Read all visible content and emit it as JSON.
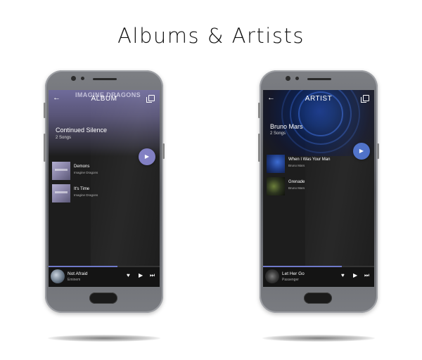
{
  "headline": "Albums & Artists",
  "left_phone": {
    "hero_title": "ALBUM",
    "hero_band_text": "IMAGINE DRAGONS",
    "item_name": "Continued Silence",
    "item_count": "2 Songs",
    "songs": [
      {
        "name": "Demons",
        "artist": "Imagine Dragons"
      },
      {
        "name": "It's Time",
        "artist": "Imagine Dragons"
      }
    ],
    "mini_player": {
      "title": "Not Afraid",
      "artist": "Eminem",
      "progress": 0.62
    }
  },
  "right_phone": {
    "hero_title": "ARTIST",
    "item_name": "Bruno Mars",
    "item_count": "2 Songs",
    "songs": [
      {
        "name": "When I Was Your Man",
        "artist": "Bruno Mars"
      },
      {
        "name": "Grenade",
        "artist": "Bruno Mars"
      }
    ],
    "mini_player": {
      "title": "Let Her Go",
      "artist": "Passenger",
      "progress": 0.71
    }
  },
  "icons": {
    "back": "←",
    "play": "▶",
    "heart": "♥",
    "next": "⏭"
  },
  "colors": {
    "album_accent": "#7d7bc1",
    "artist_accent": "#4a6ec8",
    "progress": "#6f79c9"
  }
}
